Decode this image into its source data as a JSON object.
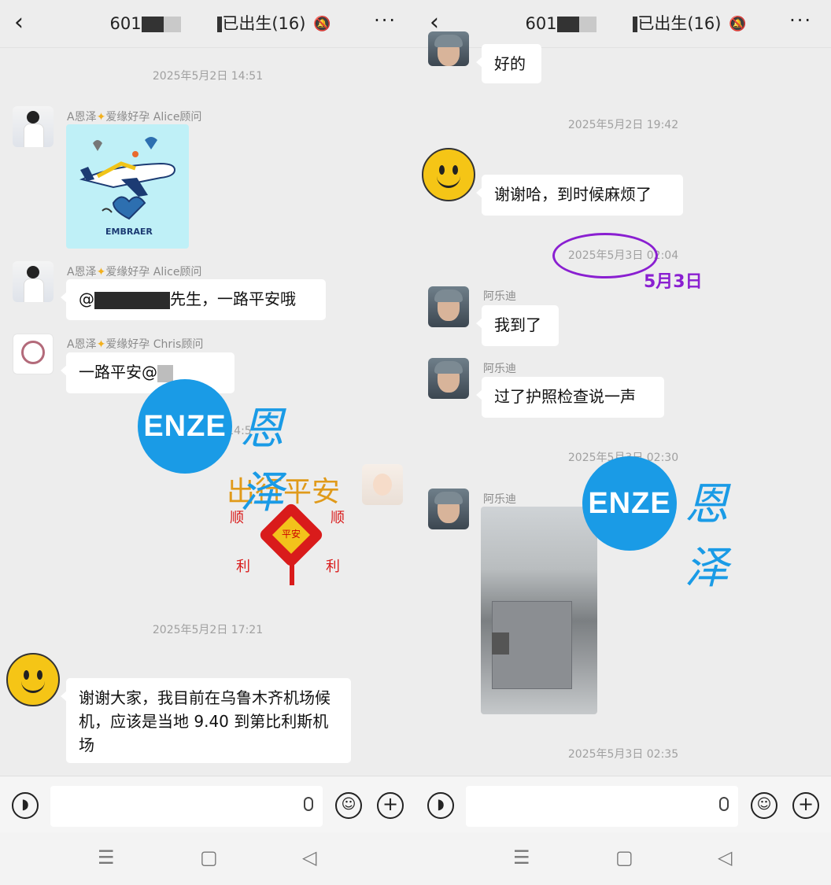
{
  "left": {
    "header": {
      "title_prefix": "601",
      "title_suffix": "已出生(16)",
      "more": "···",
      "back": "‹"
    },
    "messages": {
      "ts1": "2025年5月2日 14:51",
      "sender_alice_1": "A恩泽",
      "sender_alice_1b": "爱缘好孕 Alice顾问",
      "plane_brand": "EMBRAER",
      "sender_alice_2": "A恩泽",
      "sender_alice_2b": "爱缘好孕 Alice顾问",
      "bubble_alice_at": "@",
      "bubble_alice_rest": "先生，一路平安哦",
      "sender_chris": "A恩泽",
      "sender_chris_b": "爱缘好孕 Chris顾问",
      "bubble_chris": "一路平安@",
      "ts_partial": "14:5",
      "sticker_main": "出行平安",
      "sticker_left1": "顺",
      "sticker_right1": "顺",
      "sticker_left2": "利",
      "sticker_right2": "利",
      "sticker_knot": "平安",
      "ts2": "2025年5月2日 17:21",
      "bubble_thanks": "谢谢大家，我目前在乌鲁木齐机场候机，应该是当地 9.40 到第比利斯机场"
    }
  },
  "right": {
    "header": {
      "title_prefix": "601",
      "title_suffix": "已出生(16)",
      "more": "···",
      "back": "‹"
    },
    "messages": {
      "bubble_ok": "好的",
      "ts1": "2025年5月2日 19:42",
      "bubble_thanks": "谢谢哈，到时候麻烦了",
      "ts2": "2025年5月3日 02:04",
      "annotation": "5月3日",
      "sender1": "阿乐迪",
      "bubble_arrived": "我到了",
      "sender2": "阿乐迪",
      "bubble_passport": "过了护照检查说一声",
      "ts3": "2025年5月3日 02:30",
      "sender3": "阿乐迪",
      "ts4": "2025年5月3日 02:35"
    }
  },
  "watermark": {
    "logo": "ENZE",
    "text": "恩泽"
  },
  "nav": {
    "menu": "☰",
    "home": "▢",
    "back": "◁"
  },
  "icons": {
    "voice": "voice-icon",
    "emoji": "emoji-icon",
    "plus": "plus-icon",
    "mic": "mic-icon",
    "mute": "bell-off-icon"
  }
}
